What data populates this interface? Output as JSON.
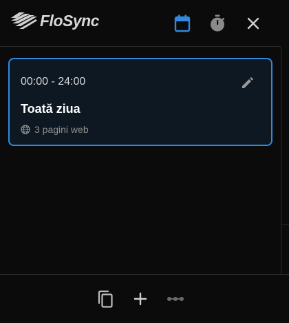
{
  "app": {
    "name": "FloSync"
  },
  "header": {
    "icons": [
      "calendar-icon",
      "timer-icon",
      "close-icon"
    ],
    "accent_color": "#2f8ae0",
    "inactive_icon_color": "#8a8a8a"
  },
  "schedule": {
    "items": [
      {
        "time_range": "00:00 - 24:00",
        "title": "Toată ziua",
        "meta": "3 pagini web",
        "icons": [
          "edit-icon",
          "globe-icon"
        ]
      }
    ]
  },
  "footer": {
    "icons": [
      "copy-icon",
      "add-icon",
      "more-icon"
    ],
    "disabled_color": "#6a6a6a"
  },
  "colors": {
    "background": "#0b0b0b",
    "card_background": "#0e1822",
    "card_border": "#2f8ae0",
    "divider": "#2a2a2a"
  }
}
